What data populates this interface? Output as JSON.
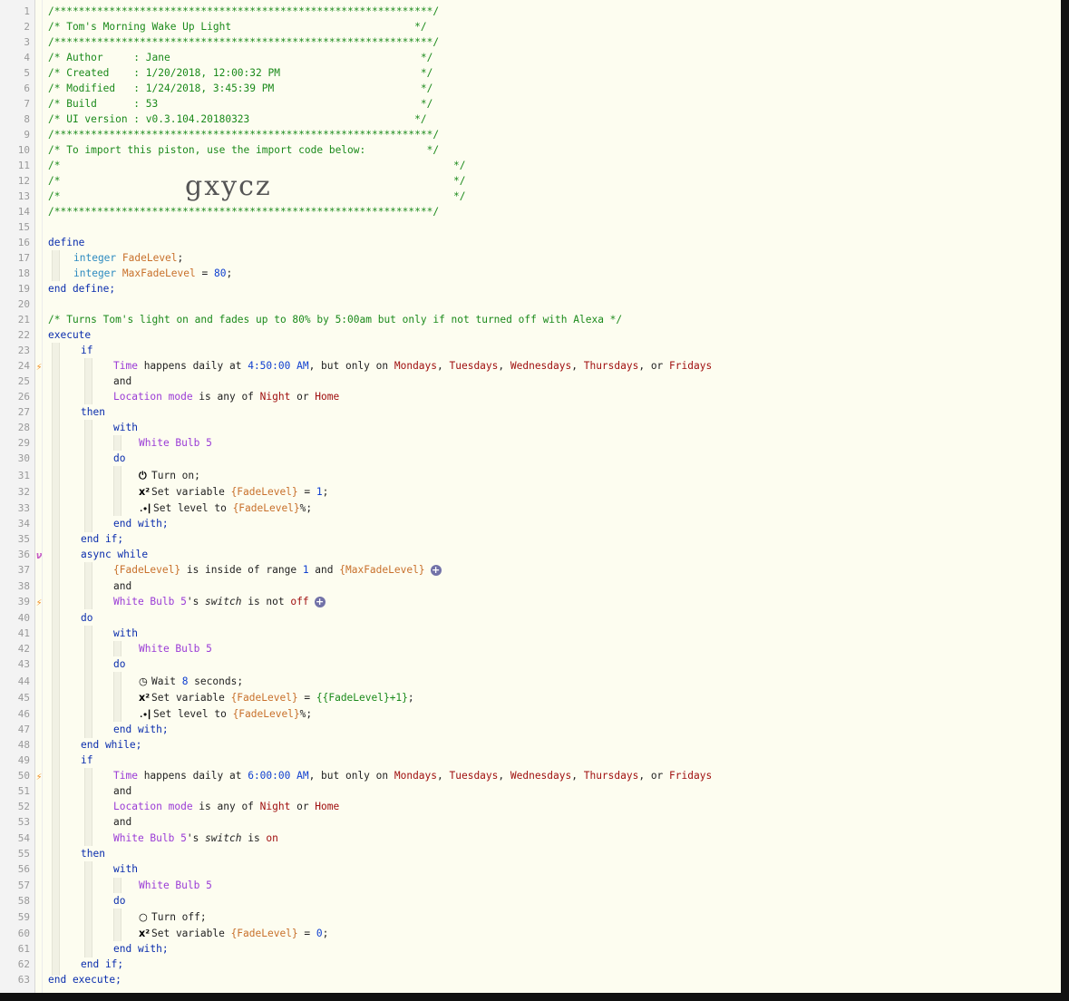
{
  "header": {
    "rule_top": "/**************************************************************/",
    "title_line": "/* Tom's Morning Wake Up Light                              */",
    "author_line": "/* Author     : Jane                                         */",
    "created_line": "/* Created    : 1/20/2018, 12:00:32 PM                       */",
    "modified_line": "/* Modified   : 1/24/2018, 3:45:39 PM                        */",
    "build_line": "/* Build      : 53                                           */",
    "ui_line": "/* UI version : v0.3.104.20180323                           */",
    "import_line": "/* To import this piston, use the import code below:          */",
    "blank_open": "/*",
    "blank_close": "*/",
    "import_code": "gxycz"
  },
  "define": {
    "open": "define",
    "type": "integer",
    "var1": "FadeLevel",
    "var2": "MaxFadeLevel",
    "var2_value": "80",
    "close": "end define;"
  },
  "comment_line": "/* Turns Tom's light on and fades up to 80% by 5:00am but only if not turned off with Alexa */",
  "kw": {
    "execute": "execute",
    "if": "if",
    "then": "then",
    "with": "with",
    "do": "do",
    "and": "and",
    "end_with": "end with;",
    "end_if": "end if;",
    "async_while": "async while",
    "end_while": "end while;",
    "end_execute": "end execute;"
  },
  "conditions": {
    "time": "Time",
    "happens_daily_at": " happens daily at ",
    "time1": "4:50:00 AM",
    "time2": "6:00:00 AM",
    "but_only_on": ", but only on ",
    "mon": "Mondays",
    "tue": "Tuesdays",
    "wed": "Wednesdays",
    "thu": "Thursdays",
    "fri": "Fridays",
    "comma": ", ",
    "or_": ", or ",
    "location_mode": "Location mode",
    "is_any_of": " is any of ",
    "night": "Night",
    "or_word": " or ",
    "home": "Home",
    "fade_ref": "{FadeLevel}",
    "max_ref": "{MaxFadeLevel}",
    "inside_range": " is inside of range ",
    "range_low": "1",
    "and_word": " and ",
    "bulb_poss": "White Bulb 5",
    "s_word": "'s ",
    "switch": "switch",
    "is_not": " is not ",
    "off": "off",
    "is_word": " is ",
    "on": "on"
  },
  "device": "White Bulb 5",
  "actions": {
    "turn_on": "Turn on;",
    "set_variable": "Set variable ",
    "equals": " = ",
    "val_1": "1",
    "val_0": "0",
    "semicolon": ";",
    "set_level": "Set level to ",
    "pct": "%;",
    "wait": "Wait ",
    "wait_secs": "8",
    "seconds": " seconds;",
    "expr": "{{FadeLevel}+1}",
    "turn_off": "Turn off;"
  },
  "line_numbers": [
    "1",
    "2",
    "3",
    "4",
    "5",
    "6",
    "7",
    "8",
    "9",
    "10",
    "11",
    "12",
    "13",
    "14",
    "15",
    "16",
    "17",
    "18",
    "19",
    "20",
    "21",
    "22",
    "23",
    "24",
    "25",
    "26",
    "27",
    "28",
    "29",
    "30",
    "31",
    "32",
    "33",
    "34",
    "35",
    "36",
    "37",
    "38",
    "39",
    "40",
    "41",
    "42",
    "43",
    "44",
    "45",
    "46",
    "47",
    "48",
    "49",
    "50",
    "51",
    "52",
    "53",
    "54",
    "55",
    "56",
    "57",
    "58",
    "59",
    "60",
    "61",
    "62",
    "63"
  ],
  "icons": {
    "bolt": "⚡",
    "async": "ν",
    "power": "⏻",
    "var": "x²",
    "signal": ".∙┃",
    "clock": "◷",
    "off_circle": "○",
    "plus": "+"
  }
}
